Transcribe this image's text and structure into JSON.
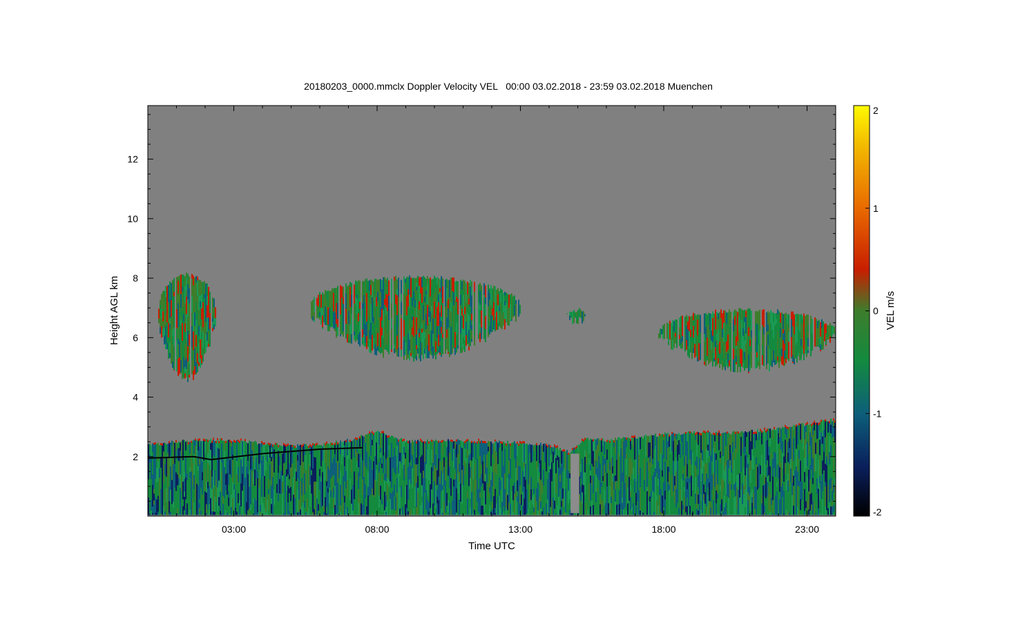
{
  "chart_data": {
    "type": "heatmap",
    "title": "20180203_0000.mmclx Doppler Velocity VEL   00:00 03.02.2018 - 23:59 03.02.2018 Muenchen",
    "xlabel": "Time UTC",
    "ylabel": "Height AGL km",
    "x_ticks": [
      "03:00",
      "08:00",
      "13:00",
      "18:00",
      "23:00"
    ],
    "x_tick_hours": [
      3,
      8,
      13,
      18,
      23
    ],
    "xlim_hours": [
      0,
      24
    ],
    "y_ticks": [
      "2",
      "4",
      "6",
      "8",
      "10",
      "12"
    ],
    "y_tick_values": [
      2,
      4,
      6,
      8,
      10,
      12
    ],
    "ylim_km": [
      0,
      13.8
    ],
    "colorbar": {
      "label": "VEL m/s",
      "ticks": [
        "2",
        "1",
        "0",
        "-1",
        "-2"
      ],
      "tick_values": [
        2,
        1,
        0,
        -1,
        -2
      ],
      "range": [
        -2,
        2
      ]
    },
    "background_color": "#808080",
    "velocity_colors": {
      "minus2": "#000000",
      "minus1": "#0d5f7a",
      "minus05": "#138a3e",
      "zero": "#3d7d2c",
      "plus05": "#c81e00",
      "plus1": "#e96a00",
      "plus2": "#fffa00"
    },
    "echo_regions": [
      {
        "description_time_start_h": 0.35,
        "time_end_h": 2.35,
        "base_km": 4.5,
        "top_km": 8.2
      },
      {
        "description_time_start_h": 5.6,
        "time_end_h": 13.0,
        "base_km": 5.2,
        "top_km": 8.1
      },
      {
        "description_time_start_h": 14.6,
        "time_end_h": 15.3,
        "base_km": 6.4,
        "top_km": 7.0
      },
      {
        "description_time_start_h": 17.8,
        "time_end_h": 24.0,
        "base_km": 4.8,
        "top_km": 7.0
      },
      {
        "description_time_start_h": 0.0,
        "time_end_h": 24.0,
        "base_km": 0.0,
        "top_km": 3.2
      }
    ],
    "boundary_layer_top_km": [
      [
        0,
        2.4
      ],
      [
        1,
        2.5
      ],
      [
        2,
        2.55
      ],
      [
        3,
        2.55
      ],
      [
        4,
        2.45
      ],
      [
        5,
        2.35
      ],
      [
        6,
        2.4
      ],
      [
        7,
        2.55
      ],
      [
        8,
        2.85
      ],
      [
        9,
        2.5
      ],
      [
        10,
        2.55
      ],
      [
        11,
        2.55
      ],
      [
        12,
        2.5
      ],
      [
        13,
        2.45
      ],
      [
        14,
        2.4
      ],
      [
        14.7,
        2.15
      ],
      [
        15.2,
        2.6
      ],
      [
        16,
        2.55
      ],
      [
        17,
        2.65
      ],
      [
        18,
        2.75
      ],
      [
        19,
        2.8
      ],
      [
        20,
        2.8
      ],
      [
        21,
        2.85
      ],
      [
        22,
        2.95
      ],
      [
        23,
        3.1
      ],
      [
        24,
        3.25
      ]
    ],
    "black_layer_km": [
      [
        0,
        1.95
      ],
      [
        1.6,
        2.0
      ],
      [
        2.2,
        1.9
      ],
      [
        4,
        2.1
      ],
      [
        6,
        2.25
      ],
      [
        7.5,
        2.3
      ]
    ]
  }
}
